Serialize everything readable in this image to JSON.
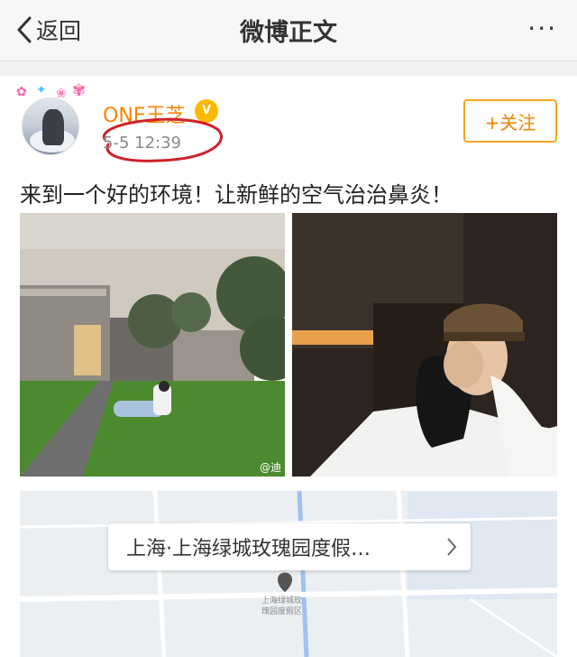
{
  "nav": {
    "back_label": "返回",
    "title": "微博正文",
    "more_label": "···"
  },
  "post": {
    "username": "ONE王芝",
    "vip_badge": "V",
    "time": "5-5 12:39",
    "follow_label": "+关注",
    "text": "来到一个好的环境！让新鲜的空气治治鼻炎！",
    "watermark": "@迪"
  },
  "location": {
    "label": "上海·上海绿城玫瑰园度假…",
    "map_labels": [
      "上海绿城玫",
      "瑰园度假区"
    ]
  },
  "colors": {
    "brand": "#ff8200",
    "follow_border": "#f5a623",
    "circle_annotation": "#d0222a"
  }
}
